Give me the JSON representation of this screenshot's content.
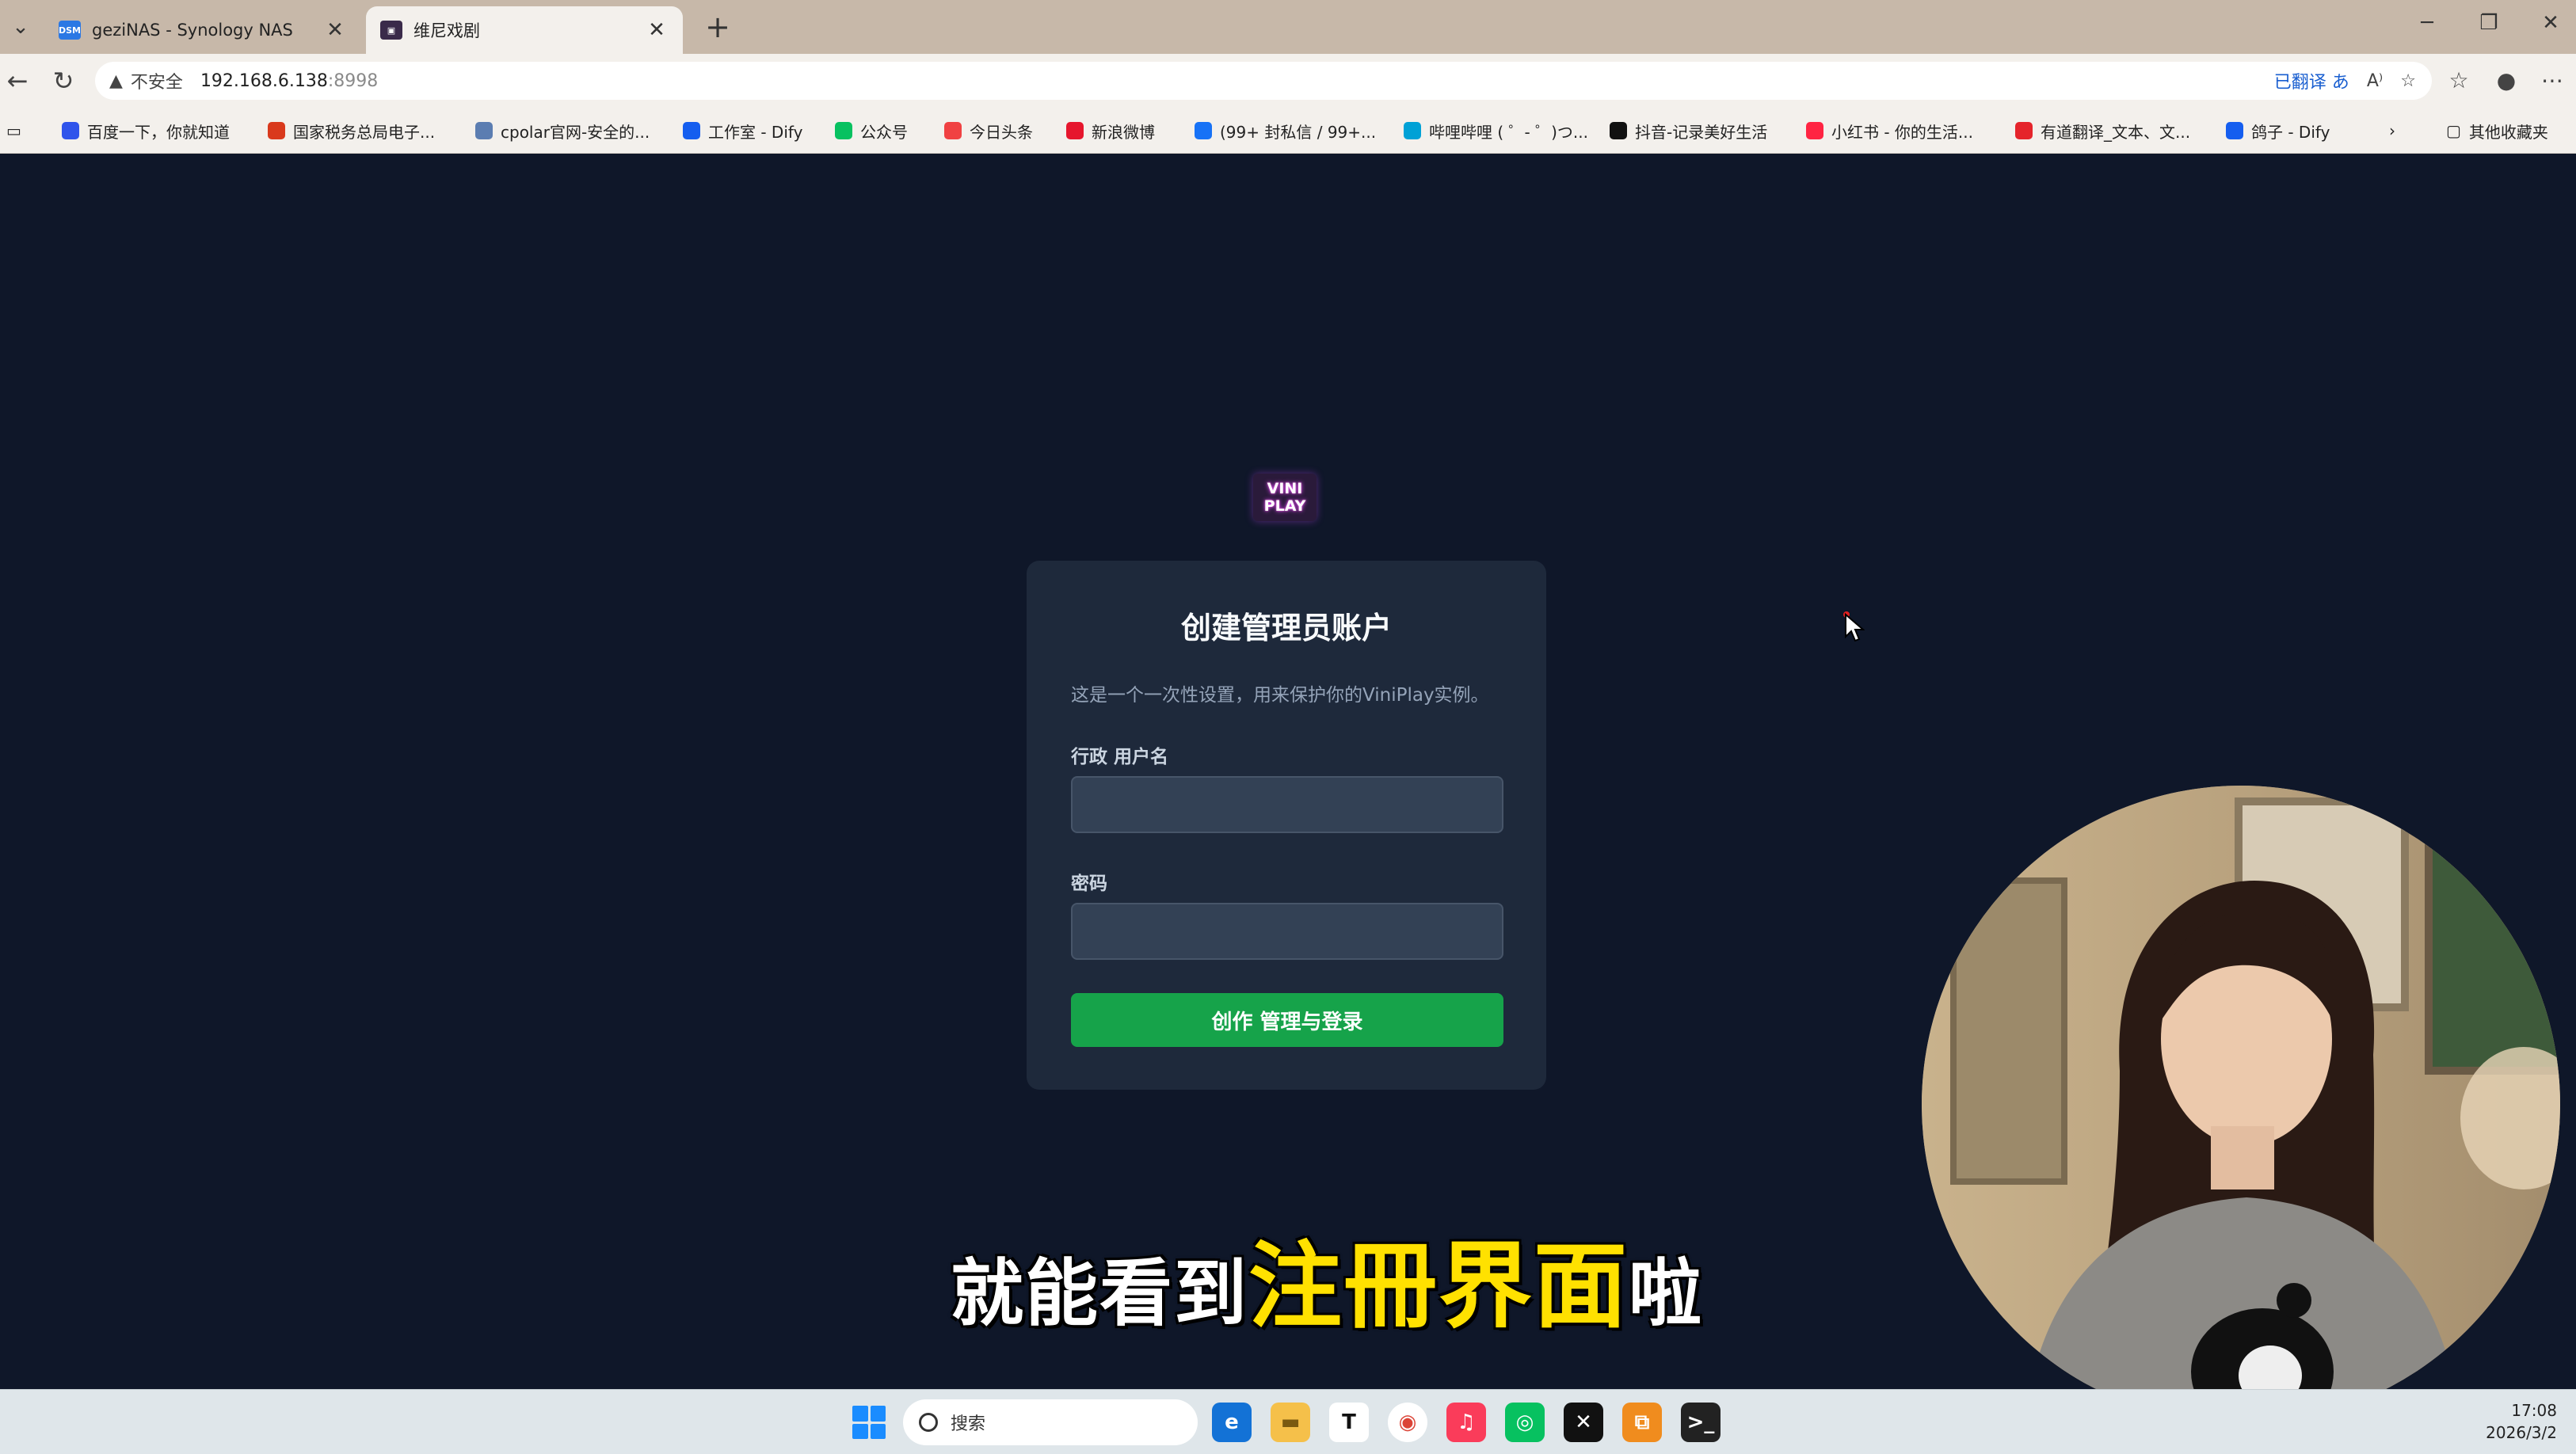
{
  "browser": {
    "tabs": [
      {
        "title": "geziNAS - Synology NAS",
        "favicon_text": "DSM",
        "favicon_color": "#2b78e4",
        "active": false
      },
      {
        "title": "维尼戏剧",
        "favicon_text": "▣",
        "favicon_color": "#3a2a4a",
        "active": true
      }
    ],
    "address": {
      "security_label": "不安全",
      "host": "192.168.6.138",
      "port": ":8998",
      "translated_label": "已翻译"
    },
    "bookmarks": [
      {
        "label": "百度一下，你就知道",
        "icon_color": "#2f54eb"
      },
      {
        "label": "国家税务总局电子...",
        "icon_color": "#d9391c"
      },
      {
        "label": "cpolar官网-安全的...",
        "icon_color": "#5b7db1"
      },
      {
        "label": "工作室 - Dify",
        "icon_color": "#155eef"
      },
      {
        "label": "公众号",
        "icon_color": "#07c160"
      },
      {
        "label": "今日头条",
        "icon_color": "#f04142"
      },
      {
        "label": "新浪微博",
        "icon_color": "#e6162d"
      },
      {
        "label": "(99+ 封私信 / 99+...",
        "icon_color": "#1772f6"
      },
      {
        "label": "哔哩哔哩 ( ゜- ゜)つ...",
        "icon_color": "#00a1d6"
      },
      {
        "label": "抖音-记录美好生活",
        "icon_color": "#111111"
      },
      {
        "label": "小红书 - 你的生活...",
        "icon_color": "#ff2442"
      },
      {
        "label": "有道翻译_文本、文...",
        "icon_color": "#e5242b"
      },
      {
        "label": "鸽子 - Dify",
        "icon_color": "#155eef"
      }
    ],
    "other_bookmarks_label": "其他收藏夹"
  },
  "page": {
    "logo_text_line1": "VINI",
    "logo_text_line2": "PLAY",
    "card": {
      "title": "创建管理员账户",
      "description": "这是一个一次性设置，用来保护你的ViniPlay实例。",
      "username_label": "行政 用户名",
      "username_value": "",
      "password_label": "密码",
      "password_value": "",
      "submit_label": "创作 管理与登录"
    }
  },
  "subtitle": {
    "prefix": "就能看到",
    "highlight": "注冊界面",
    "suffix": "啦"
  },
  "taskbar": {
    "search_placeholder": "搜索",
    "time": "17:08",
    "date": "2026/3/2"
  },
  "colors": {
    "page_bg": "#0f1729",
    "card_bg": "#1e293b",
    "submit_green": "#16a34a",
    "subtitle_highlight": "#ffe100"
  }
}
